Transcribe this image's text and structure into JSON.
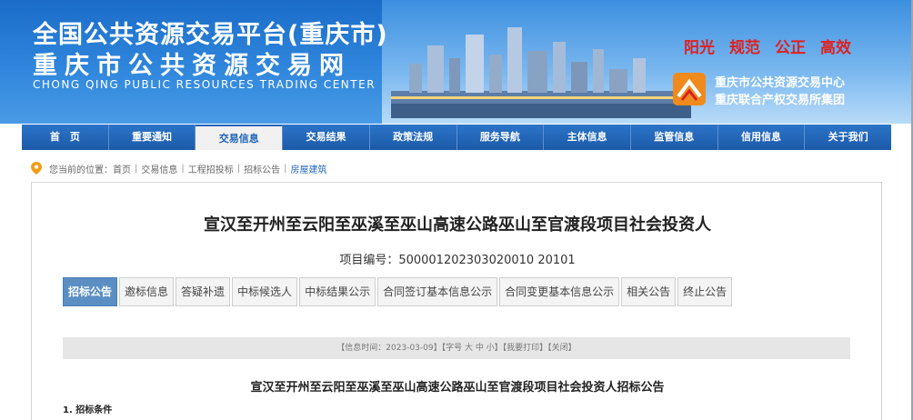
{
  "header": {
    "title_main": "全国公共资源交易平台(重庆市)",
    "title_sub": "重庆市公共资源交易网",
    "title_en": "CHONG QING PUBLIC RESOURCES TRADING CENTER",
    "slogans": [
      "阳光",
      "规范",
      "公正",
      "高效"
    ],
    "center_names": [
      "重庆市公共资源交易中心",
      "重庆联合产权交易所集团"
    ],
    "colors": {
      "slogan": "#e02020",
      "banner": "#1a6cc8"
    }
  },
  "nav": {
    "items": [
      "首　页",
      "重要通知",
      "交易信息",
      "交易结果",
      "政策法规",
      "服务导航",
      "主体信息",
      "监管信息",
      "信用信息",
      "关于我们"
    ],
    "active_index": 2
  },
  "breadcrumb": {
    "icon": "location-pin-icon",
    "prefix": "您当前的位置：",
    "items": [
      "首页",
      "交易信息",
      "工程招投标",
      "招标公告",
      "房屋建筑"
    ]
  },
  "project": {
    "title": "宣汉至开州至云阳至巫溪至巫山高速公路巫山至官渡段项目社会投资人",
    "code": "项目编号：500001202303020010 20101"
  },
  "tabs": [
    "招标公告",
    "邀标信息",
    "答疑补遗",
    "中标候选人",
    "中标结果公示",
    "合同签订基本信息公示",
    "合同变更基本信息公示",
    "相关公告",
    "终止公告"
  ],
  "infobar": {
    "text": "【信息时间：2023-03-09】【字号 大 中 小】【我要打印】【关闭】"
  },
  "notice": {
    "title": "宣汉至开州至云阳至巫溪至巫山高速公路巫山至官渡段项目社会投资人招标公告",
    "section1": "1. 招标条件"
  }
}
